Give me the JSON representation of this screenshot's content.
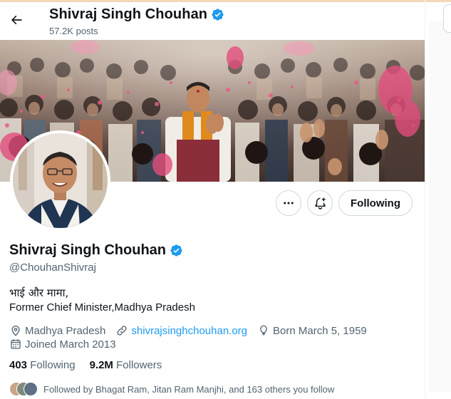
{
  "header": {
    "name": "Shivraj Singh Chouhan",
    "posts": "57.2K posts"
  },
  "profile": {
    "name": "Shivraj Singh Chouhan",
    "handle": "@ChouhanShivraj",
    "bio_line1": "भाई और मामा,",
    "bio_line2": "Former Chief Minister,Madhya Pradesh",
    "location": "Madhya Pradesh",
    "website": "shivrajsinghchouhan.org",
    "born": "Born March 5, 1959",
    "joined": "Joined March 2013"
  },
  "actions": {
    "following_label": "Following"
  },
  "counts": {
    "following_num": "403",
    "following_label": "Following",
    "followers_num": "9.2M",
    "followers_label": "Followers"
  },
  "followed_by": "Followed by Bhagat Ram, Jitan Ram Manjhi, and 163 others you follow",
  "icons": {
    "back": "arrow-left-icon",
    "verified": "verified-badge-icon",
    "more": "more-dots-icon",
    "notify": "bell-plus-icon",
    "location": "location-pin-icon",
    "link": "link-icon",
    "birthday": "balloon-icon",
    "calendar": "calendar-icon"
  },
  "colors": {
    "accent": "#1d9bf0",
    "text": "#0f1419",
    "secondary": "#536471",
    "border": "#cfd9de"
  }
}
